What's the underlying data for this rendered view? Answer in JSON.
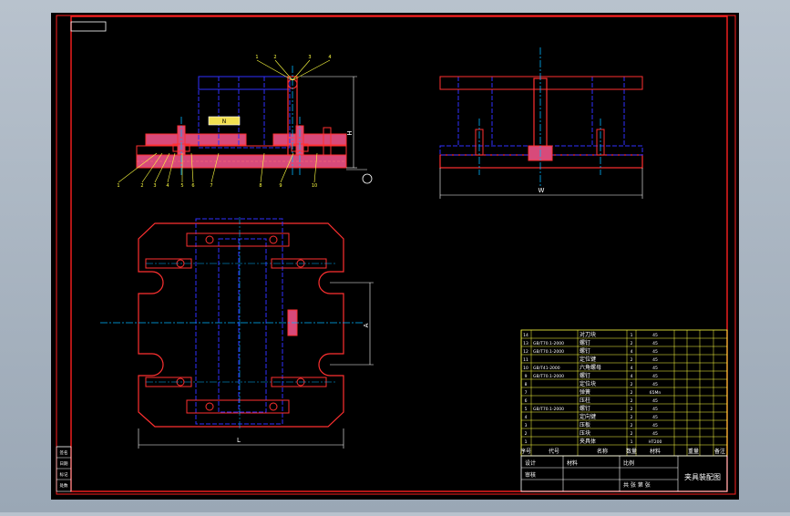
{
  "colors": {
    "background_outer": "#a7b2bf",
    "sheet": "#000000",
    "frame": "#ff2020",
    "part_outline": "#ff3030",
    "hidden_lines": "#3030ff",
    "center_lines": "#00b4ff",
    "leader_lines": "#ffff40",
    "dimension_lines": "#ffffff",
    "fill_pink": "#d84a7a",
    "table_lines": "#ffff40",
    "table_text": "#ffffff"
  },
  "drawing": {
    "dims": {
      "front_height": "H",
      "side_width": "W",
      "plan_height": "A",
      "plan_width": "L"
    },
    "balloons_top": [
      "1",
      "2",
      "3",
      "4"
    ],
    "balloons_bottom": [
      "1",
      "2",
      "3",
      "4",
      "5",
      "6",
      "7",
      "8",
      "9",
      "10"
    ],
    "nameplate": "N"
  },
  "bom": {
    "rows": [
      {
        "no": "14",
        "code": "",
        "name": "对刀块",
        "qty": "1",
        "material": "45",
        "note": ""
      },
      {
        "no": "13",
        "code": "GB/T70.1-2000",
        "name": "螺钉",
        "qty": "2",
        "material": "45",
        "note": ""
      },
      {
        "no": "12",
        "code": "GB/T70.1-2000",
        "name": "螺钉",
        "qty": "4",
        "material": "45",
        "note": ""
      },
      {
        "no": "11",
        "code": "",
        "name": "定位键",
        "qty": "2",
        "material": "45",
        "note": ""
      },
      {
        "no": "10",
        "code": "GB/T41-2000",
        "name": "六角螺母",
        "qty": "4",
        "material": "45",
        "note": ""
      },
      {
        "no": "9",
        "code": "GB/T70.1-2000",
        "name": "螺钉",
        "qty": "4",
        "material": "45",
        "note": ""
      },
      {
        "no": "8",
        "code": "",
        "name": "定位块",
        "qty": "2",
        "material": "45",
        "note": ""
      },
      {
        "no": "7",
        "code": "",
        "name": "弹簧",
        "qty": "2",
        "material": "65Mn",
        "note": ""
      },
      {
        "no": "6",
        "code": "",
        "name": "压柱",
        "qty": "2",
        "material": "45",
        "note": ""
      },
      {
        "no": "5",
        "code": "GB/T70.1-2000",
        "name": "螺钉",
        "qty": "2",
        "material": "45",
        "note": ""
      },
      {
        "no": "4",
        "code": "",
        "name": "定向键",
        "qty": "2",
        "material": "45",
        "note": ""
      },
      {
        "no": "3",
        "code": "",
        "name": "压板",
        "qty": "2",
        "material": "45",
        "note": ""
      },
      {
        "no": "2",
        "code": "",
        "name": "压块",
        "qty": "2",
        "material": "45",
        "note": ""
      },
      {
        "no": "1",
        "code": "",
        "name": "夹具体",
        "qty": "1",
        "material": "HT200",
        "note": ""
      }
    ],
    "header": {
      "no": "序号",
      "code": "代号",
      "name": "名称",
      "qty": "数量",
      "material": "材料",
      "unit_weight": "单件",
      "total_weight": "总计",
      "weight_label": "重量",
      "note": "备注"
    }
  },
  "titleblock": {
    "title": "夹具装配图",
    "designer_label": "设计",
    "checker_label": "审核",
    "scale_label": "比例",
    "sheet_label": "共 张 第 张",
    "material_label": "材料",
    "left_strip": [
      "签名",
      "日期",
      "标记",
      "处数"
    ]
  }
}
